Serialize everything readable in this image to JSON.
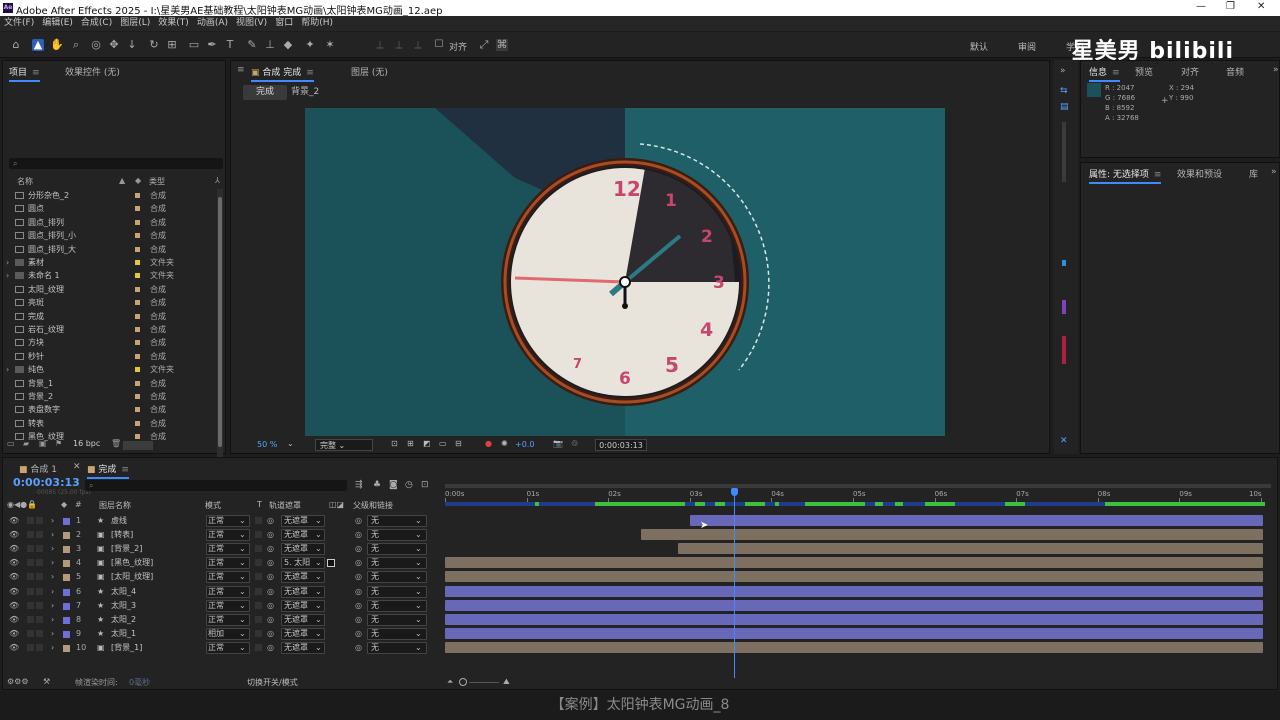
{
  "window": {
    "title": "Adobe After Effects 2025 - I:\\星美男AE基础教程\\太阳钟表MG动画\\太阳钟表MG动画_12.aep",
    "min": "—",
    "max": "❐",
    "close": "✕"
  },
  "menu": [
    "文件(F)",
    "编辑(E)",
    "合成(C)",
    "图层(L)",
    "效果(T)",
    "动画(A)",
    "视图(V)",
    "窗口",
    "帮助(H)"
  ],
  "toolbar": {
    "align_label": "对齐",
    "workspaces": [
      "默认",
      "审阅",
      "学习"
    ]
  },
  "logo": "星美男  bilibili",
  "project": {
    "tab": "项目",
    "effects_tab": "效果控件 (无)",
    "col_name": "名称",
    "col_type": "类型",
    "bpc": "16 bpc",
    "items": [
      {
        "name": "分形杂色_2",
        "type": "合成",
        "color": "#c8a46e",
        "folder": false
      },
      {
        "name": "圆点",
        "type": "合成",
        "color": "#c8a46e",
        "folder": false
      },
      {
        "name": "圆点_排列",
        "type": "合成",
        "color": "#c8a46e",
        "folder": false
      },
      {
        "name": "圆点_排列_小",
        "type": "合成",
        "color": "#c8a46e",
        "folder": false
      },
      {
        "name": "圆点_排列_大",
        "type": "合成",
        "color": "#c8a46e",
        "folder": false
      },
      {
        "name": "素材",
        "type": "文件夹",
        "color": "#e2c934",
        "folder": true
      },
      {
        "name": "未命名 1",
        "type": "文件夹",
        "color": "#e2c934",
        "folder": true
      },
      {
        "name": "太阳_纹理",
        "type": "合成",
        "color": "#c8a46e",
        "folder": false
      },
      {
        "name": "亮斑",
        "type": "合成",
        "color": "#c8a46e",
        "folder": false
      },
      {
        "name": "完成",
        "type": "合成",
        "color": "#c8a46e",
        "folder": false
      },
      {
        "name": "岩石_纹理",
        "type": "合成",
        "color": "#c8a46e",
        "folder": false
      },
      {
        "name": "方块",
        "type": "合成",
        "color": "#c8a46e",
        "folder": false
      },
      {
        "name": "秒针",
        "type": "合成",
        "color": "#c8a46e",
        "folder": false
      },
      {
        "name": "纯色",
        "type": "文件夹",
        "color": "#e2c934",
        "folder": true
      },
      {
        "name": "背景_1",
        "type": "合成",
        "color": "#c8a46e",
        "folder": false
      },
      {
        "name": "背景_2",
        "type": "合成",
        "color": "#c8a46e",
        "folder": false
      },
      {
        "name": "表盘数字",
        "type": "合成",
        "color": "#c8a46e",
        "folder": false
      },
      {
        "name": "转表",
        "type": "合成",
        "color": "#c8a46e",
        "folder": false
      },
      {
        "name": "黑色_纹理",
        "type": "合成",
        "color": "#c8a46e",
        "folder": false
      }
    ]
  },
  "comp": {
    "tab": "合成 完成",
    "layer_tab": "图层 (无)",
    "crumb_active": "完成",
    "crumb_next": "背景_2",
    "zoom": "50 %",
    "quality": "完整",
    "exposure": "+0.0",
    "time": "0:00:03:13",
    "clock_numbers": [
      "12",
      "1",
      "2",
      "3",
      "4",
      "5",
      "6",
      "7"
    ]
  },
  "info": {
    "tabs": [
      "信息",
      "预览",
      "对齐",
      "音频"
    ],
    "r": "R : 2047",
    "g": "G : 7686",
    "b": "B : 8592",
    "a": "A : 32768",
    "x": "X : 294",
    "y": "Y : 990",
    "swatch": "#1b525a"
  },
  "props": {
    "tab": "属性: 无选择项",
    "tab2": "效果和预设",
    "tab3": "库"
  },
  "timeline": {
    "tabs": [
      "合成 1",
      "完成"
    ],
    "time": "0:00:03:13",
    "fps": "00085 (25.00 fps)",
    "col_name": "图层名称",
    "col_mode": "模式",
    "col_t": "T",
    "col_track": "轨道遮罩",
    "col_parent": "父级和链接",
    "ruler": [
      "0:00s",
      "01s",
      "02s",
      "03s",
      "04s",
      "05s",
      "06s",
      "07s",
      "08s",
      "09s",
      "10s"
    ],
    "render_label": "帧渲染时间:",
    "render_val": "0毫秒",
    "toggle_label": "切换开关/模式",
    "playhead": 0.353,
    "layers": [
      {
        "n": "1",
        "name": "虚线",
        "mode": "正常",
        "track": "无遮罩",
        "parent": "无",
        "color": "#6f6fd8",
        "bar": "#6868b8",
        "start": 0.3,
        "end": 1.0,
        "icon": "star-icon"
      },
      {
        "n": "2",
        "name": "[转表]",
        "mode": "正常",
        "track": "无遮罩",
        "parent": "无",
        "color": "#b39a7a",
        "bar": "#7e7060",
        "start": 0.24,
        "end": 1.0,
        "icon": "comp-icon"
      },
      {
        "n": "3",
        "name": "[背景_2]",
        "mode": "正常",
        "track": "无遮罩",
        "parent": "无",
        "color": "#b39a7a",
        "bar": "#7e7060",
        "start": 0.285,
        "end": 1.0,
        "icon": "comp-icon"
      },
      {
        "n": "4",
        "name": "[黑色_纹理]",
        "mode": "正常",
        "track": "5. 太阳",
        "parent": "无",
        "color": "#b39a7a",
        "bar": "#7e7060",
        "start": 0.0,
        "end": 1.0,
        "icon": "comp-icon"
      },
      {
        "n": "5",
        "name": "[太阳_纹理]",
        "mode": "正常",
        "track": "无遮罩",
        "parent": "无",
        "color": "#b39a7a",
        "bar": "#7e7060",
        "start": 0.0,
        "end": 1.0,
        "icon": "comp-icon"
      },
      {
        "n": "6",
        "name": "太阳_4",
        "mode": "正常",
        "track": "无遮罩",
        "parent": "无",
        "color": "#6f6fd8",
        "bar": "#6868b8",
        "start": 0.0,
        "end": 1.0,
        "icon": "star-icon"
      },
      {
        "n": "7",
        "name": "太阳_3",
        "mode": "正常",
        "track": "无遮罩",
        "parent": "无",
        "color": "#6f6fd8",
        "bar": "#6868b8",
        "start": 0.0,
        "end": 1.0,
        "icon": "star-icon"
      },
      {
        "n": "8",
        "name": "太阳_2",
        "mode": "正常",
        "track": "无遮罩",
        "parent": "无",
        "color": "#6f6fd8",
        "bar": "#6868b8",
        "start": 0.0,
        "end": 1.0,
        "icon": "star-icon"
      },
      {
        "n": "9",
        "name": "太阳_1",
        "mode": "相加",
        "track": "无遮罩",
        "parent": "无",
        "color": "#6f6fd8",
        "bar": "#6868b8",
        "start": 0.0,
        "end": 1.0,
        "icon": "star-icon"
      },
      {
        "n": "10",
        "name": "[背景_1]",
        "mode": "正常",
        "track": "无遮罩",
        "parent": "无",
        "color": "#b39a7a",
        "bar": "#7e7060",
        "start": 0.0,
        "end": 1.0,
        "icon": "comp-icon"
      }
    ]
  },
  "caption": "【案例】太阳钟表MG动画_8"
}
